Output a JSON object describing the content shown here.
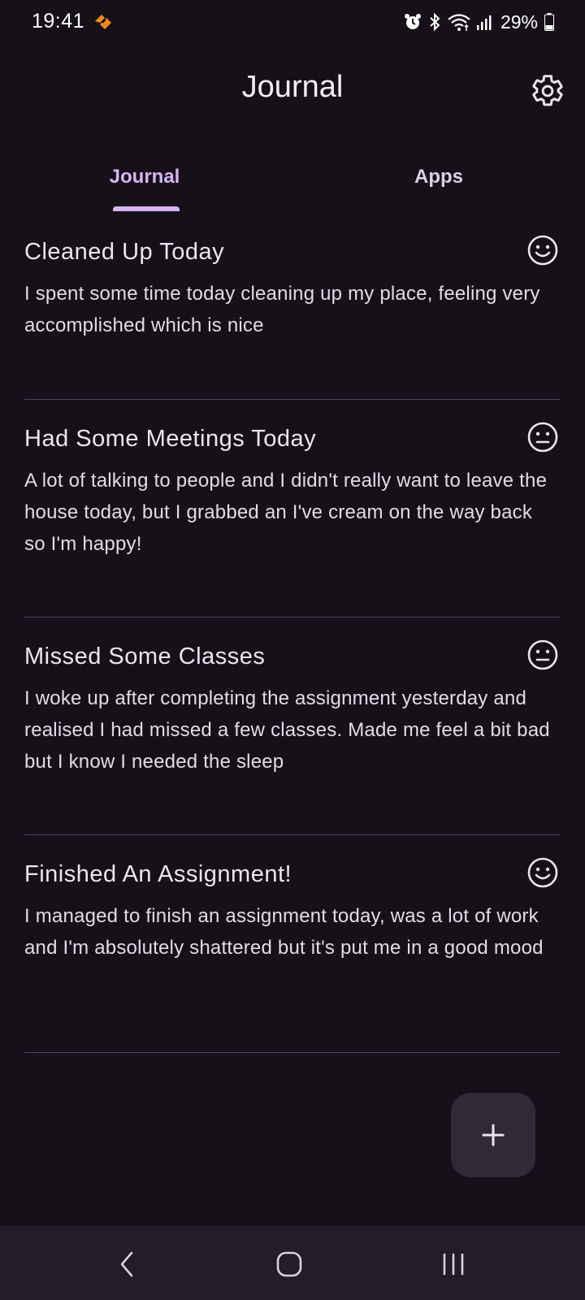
{
  "status_bar": {
    "time": "19:41",
    "battery": "29%"
  },
  "header": {
    "title": "Journal",
    "settings_icon": "gear-icon"
  },
  "tabs": [
    {
      "label": "Journal",
      "selected": true
    },
    {
      "label": "Apps",
      "selected": false
    }
  ],
  "entries": [
    {
      "title": "Cleaned Up Today",
      "body": "I spent some time today cleaning up my place, feeling very accomplished which is nice",
      "mood": "happy-face-icon"
    },
    {
      "title": "Had Some Meetings Today",
      "body": "A lot of talking to people and I didn't really want to leave the house today, but I grabbed an I've cream on the way back so I'm happy!",
      "mood": "neutral-face-icon"
    },
    {
      "title": "Missed Some Classes",
      "body": "I woke up after completing the assignment yesterday and realised I had missed a few classes. Made me feel a bit bad but I know I needed the sleep",
      "mood": "neutral-face-icon"
    },
    {
      "title": "Finished An Assignment!",
      "body": "I managed to finish an assignment today, was a lot of work and I'm absolutely shattered but it's put me in a good mood",
      "mood": "happy-face-icon"
    }
  ],
  "fab": {
    "icon": "plus-icon"
  },
  "colors": {
    "background": "#161118",
    "accent": "#d6b4f4",
    "fab": "#2f2a33",
    "nav_bar": "#221d29"
  }
}
